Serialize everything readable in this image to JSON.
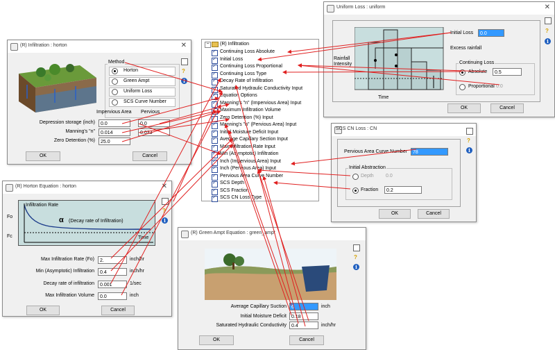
{
  "tree": {
    "root_label": "(R) Infiltration",
    "expand_symbol": "−",
    "items": [
      "Continuing Loss Absolute",
      "Initial Loss",
      "Continuing Loss Proportional",
      "Continuing Loss Type",
      "Decay Rate of Infiltration",
      "Saturated Hydraulic Conductivity Input",
      "Equation Options",
      "Manning's \"n\" (Impervious Area) Input",
      "Maximum Infiltration Volume",
      "Zero Detention (%) Input",
      "Manning's \"n\" (Pervious Area) Input",
      "Initial Moisture Deficit Input",
      "Average Capillary Section Input",
      "Max Infiltration Rate Input",
      "Min (Asymptotic) Infiltration",
      "Inch (Impervious Area) Input",
      "Inch (Pervious Area) Input",
      "Pervious Area Curve Number",
      "SCS Depth",
      "SCS Fraction",
      "SCS CN Loss Type"
    ]
  },
  "horton_infiltration": {
    "title": "(R) Infiltration : horton",
    "method_label": "Method",
    "methods": [
      "Horton",
      "Green Ampt",
      "Uniform Loss",
      "SCS Curve Number"
    ],
    "col_impervious": "Impervious Area",
    "col_pervious": "Pervious",
    "rows": [
      {
        "label": "Depression storage   (inch)",
        "imp": "0.0",
        "perv": "0.0"
      },
      {
        "label": "Manning's \"n\"",
        "imp": "0.014",
        "perv": "0.033"
      },
      {
        "label": "Zero Detention (%)",
        "imp": "25.0",
        "perv": ""
      }
    ],
    "ok": "OK",
    "cancel": "Cancel"
  },
  "horton_equation": {
    "title": "(R) Horton Equation : horton",
    "chart_label": "Infiltration Rate",
    "fo": "Fo",
    "fc": "Fc",
    "alpha_symbol": "α",
    "decay_note": "(Decay rate of Infiltration)",
    "time": "Time",
    "fields": [
      {
        "label": "Max Infiltration Rate (Fo)",
        "value": "2.",
        "unit": "inch/hr"
      },
      {
        "label": "Min (Asymptotic) Infiltration",
        "value": "0.4",
        "unit": "inch/hr"
      },
      {
        "label": "Decay rate of infiltration",
        "value": "0.001",
        "unit": "1/sec"
      },
      {
        "label": "Max Infiltration Volume",
        "value": "0.0",
        "unit": "inch"
      }
    ],
    "ok": "OK",
    "cancel": "Cancel"
  },
  "uniform_loss": {
    "title": "Uniform Loss : uniform",
    "initial_loss_label": "Initial Loss",
    "initial_loss_value": "0.0",
    "excess_rainfall": "Excess rainfall",
    "rainfall_intensity": "Rainfall\nIntensity",
    "time": "Time",
    "continuing_loss": "Continuing Loss",
    "absolute": "Absolute",
    "absolute_value": "0.5",
    "proportional": "Proportional",
    "proportional_value": "0.0",
    "ok": "OK",
    "cancel": "Cancel"
  },
  "scs_cn": {
    "title": "SCS CN Loss : CN",
    "cn_label": "Pervious Area Curve Number",
    "cn_value": "78",
    "initial_abstraction": "Initial Abstraction",
    "depth": "Depth",
    "depth_value": "0.0",
    "fraction": "Fraction",
    "fraction_value": "0.2",
    "ok": "OK",
    "cancel": "Cancel"
  },
  "green_ampt": {
    "title": "(R) Green Ampt Equation : green_ampt",
    "fields": [
      {
        "label": "Average Capillary Suction",
        "value": "6",
        "unit": "inch"
      },
      {
        "label": "Initial Moisture Deficit",
        "value": "0.18",
        "unit": ""
      },
      {
        "label": "Saturated Hydraulic Conductivity",
        "value": "0.4",
        "unit": "inch/hr"
      }
    ],
    "ok": "OK",
    "cancel": "Cancel"
  },
  "colors": {
    "arrow": "#e02020",
    "selection": "#3399ff",
    "chart_bg": "#c8dede"
  }
}
